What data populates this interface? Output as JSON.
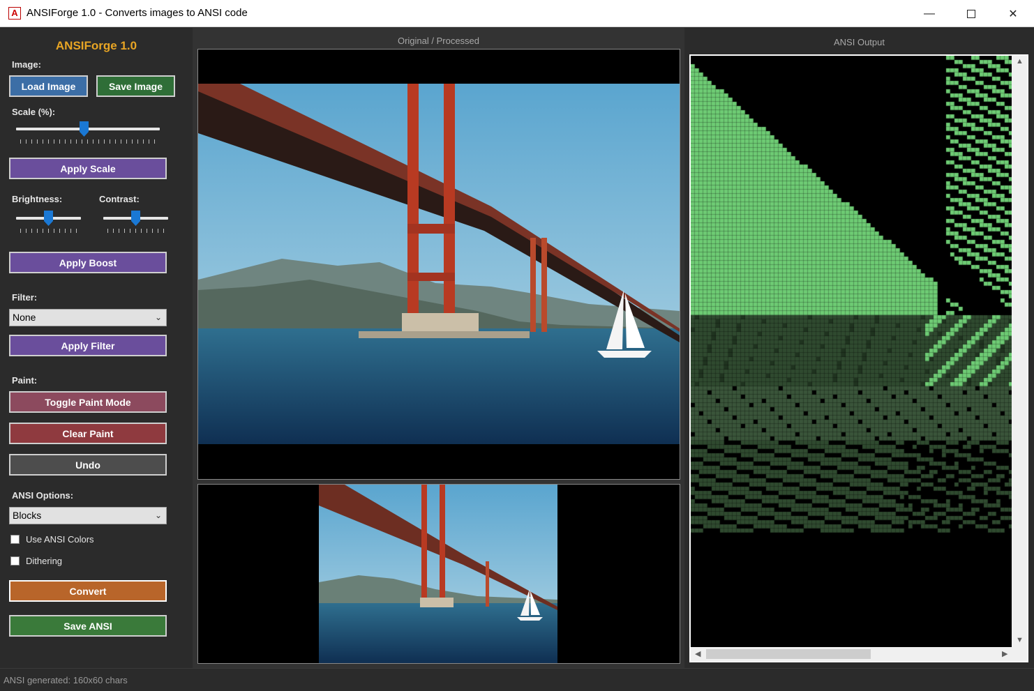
{
  "window": {
    "title": "ANSIForge 1.0 - Converts images to ANSI code",
    "icon": "A"
  },
  "sidebar": {
    "heading": "ANSIForge 1.0",
    "image_label": "Image:",
    "load_image": "Load Image",
    "save_image": "Save Image",
    "scale_label": "Scale (%):",
    "scale_value": 0.47,
    "apply_scale": "Apply Scale",
    "brightness_label": "Brightness:",
    "brightness_value": 0.5,
    "contrast_label": "Contrast:",
    "contrast_value": 0.5,
    "apply_boost": "Apply Boost",
    "filter_label": "Filter:",
    "filter_selected": "None",
    "apply_filter": "Apply Filter",
    "paint_label": "Paint:",
    "toggle_paint": "Toggle Paint Mode",
    "clear_paint": "Clear Paint",
    "undo": "Undo",
    "ansi_options_label": "ANSI Options:",
    "ansi_mode_selected": "Blocks",
    "use_ansi_colors": "Use ANSI Colors",
    "use_ansi_colors_checked": false,
    "dithering": "Dithering",
    "dithering_checked": false,
    "convert": "Convert",
    "save_ansi": "Save ANSI"
  },
  "center": {
    "title": "Original / Processed"
  },
  "right": {
    "title": "ANSI Output"
  },
  "status": {
    "text": "ANSI generated: 160x60 chars"
  },
  "colors": {
    "accent": "#e8a524",
    "load_btn": "#3c6ea6",
    "save_btn": "#2f6e37",
    "purple_btn": "#6a4e9c",
    "paint_btn": "#8c4a5e",
    "clear_btn": "#8f3a3f",
    "undo_btn": "#4d4d4d",
    "convert_btn": "#b8652a",
    "save_ansi_btn": "#3a7a3a",
    "ansi_light_green": "#6ecb74",
    "ansi_dark_green": "#2f4a2f"
  }
}
